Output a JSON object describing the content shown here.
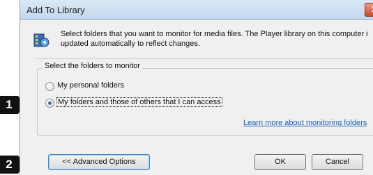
{
  "window": {
    "title": "Add To Library",
    "close_glyph": "✕"
  },
  "intro": {
    "icon": "media-library-icon",
    "text": "Select folders that you want to monitor for media files. The Player library on this computer i\nupdated automatically to reflect changes."
  },
  "folders": {
    "group_label": "Select the folders to monitor",
    "options": [
      {
        "label": "My personal folders",
        "selected": false
      },
      {
        "label": "My folders and those of others that I can access",
        "selected": true
      }
    ],
    "learn_more_link": "Learn more about monitoring folders"
  },
  "buttons": {
    "advanced": "<< Advanced Options",
    "ok": "OK",
    "cancel": "Cancel"
  },
  "callouts": {
    "first": "1",
    "second": "2"
  }
}
